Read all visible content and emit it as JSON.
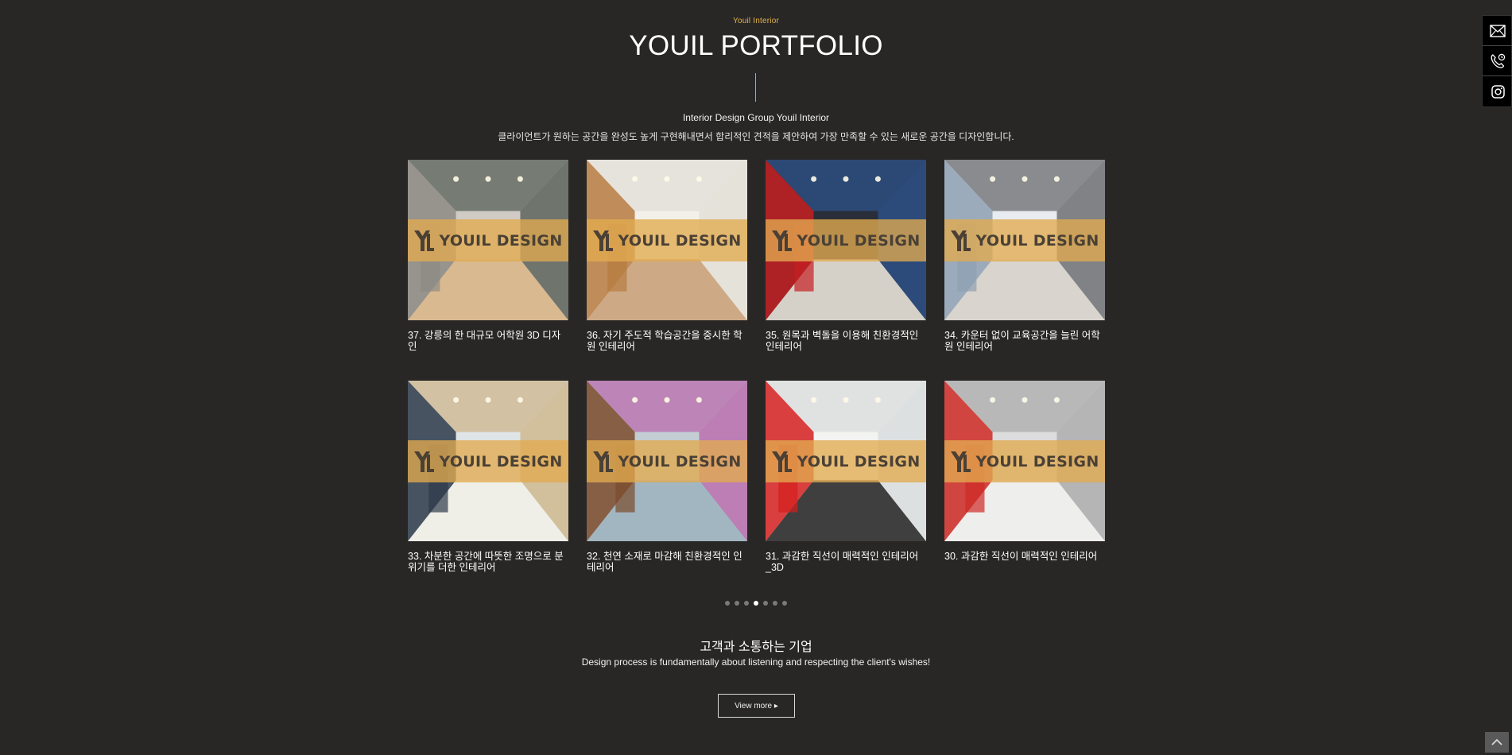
{
  "header": {
    "eyebrow": "Youil Interior",
    "title": "YOUIL PORTFOLIO",
    "tagline": "Interior Design Group Youil Interior",
    "intro": "클라이언트가 원하는 공간을 완성도 높게 구현해내면서 합리적인 견적을 제안하여 가장 만족할 수 있는 새로운 공간을 디자인합니다."
  },
  "watermark": "YOUIL DESIGN",
  "portfolio": [
    {
      "title": "37. 강릉의 한 대규모 어학원 3D 디자인",
      "palette": [
        "#cfcbc4",
        "#8d8a84",
        "#d9b78a",
        "#2e3a33"
      ]
    },
    {
      "title": "36. 자기 주도적 학습공간을 중시한 학원 인테리어",
      "palette": [
        "#f2efe9",
        "#b77a3f",
        "#c9a27a",
        "#dcd8d1"
      ]
    },
    {
      "title": "35. 원목과 벽돌을 이용해 친환경적인 인테리어",
      "palette": [
        "#2a2f38",
        "#c51f22",
        "#e9e3d8",
        "#2e5fa8"
      ]
    },
    {
      "title": "34. 카운터 없이 교육공간을 늘린 어학원 인테리어",
      "palette": [
        "#e8ecef",
        "#8ea0b2",
        "#d7d2c9",
        "#3a3c40"
      ]
    },
    {
      "title": "33. 차분한 공간에 따뜻한 조명으로 분위기를 더한 인테리어",
      "palette": [
        "#dfe3e6",
        "#2d3a49",
        "#f1efe8",
        "#c9a66b"
      ]
    },
    {
      "title": "32. 천연 소재로 마감해 친환경적인 인테리어",
      "palette": [
        "#c3cdd3",
        "#7b4b2c",
        "#9fb4bf",
        "#b84aa0"
      ]
    },
    {
      "title": "31. 과감한 직선이 매력적인 인테리어_3D",
      "palette": [
        "#f3f3f1",
        "#d41f1e",
        "#2b2b2b",
        "#cfd4d6"
      ]
    },
    {
      "title": "30. 과감한 직선이 매력적인 인테리어",
      "palette": [
        "#dcdcdc",
        "#cf2a25",
        "#f0f0ee",
        "#9b9b9b"
      ]
    }
  ],
  "pagination": {
    "count": 7,
    "active_index": 3
  },
  "section": {
    "title": "고객과 소통하는 기업",
    "subtitle": "Design process is fundamentally about listening and respecting the client's wishes!"
  },
  "view_more_label": "View more ▸",
  "quick_links": [
    {
      "icon": "mail-icon",
      "name": "email"
    },
    {
      "icon": "phone-icon",
      "name": "phone"
    },
    {
      "icon": "instagram-icon",
      "name": "instagram"
    }
  ],
  "top_button_icon": "chevron-up-icon"
}
